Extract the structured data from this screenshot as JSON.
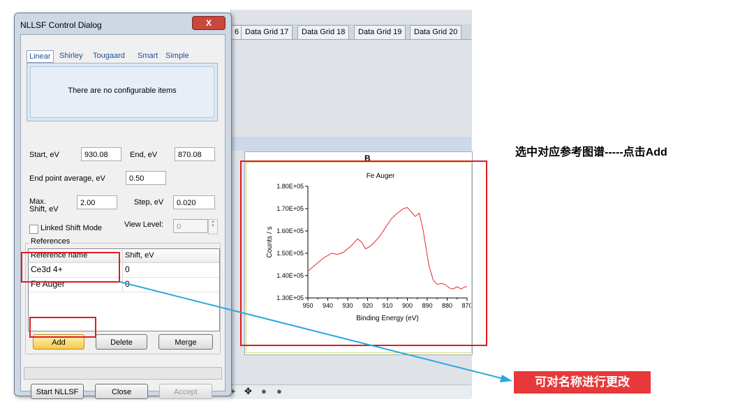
{
  "background": {
    "tabs": [
      "6",
      "Data Grid 17",
      "Data Grid 18",
      "Data Grid 19",
      "Data Grid 20"
    ],
    "graph_letter": "B"
  },
  "dialog": {
    "title": "NLLSF Control Dialog",
    "close_label": "X",
    "background_tabs": [
      "Linear",
      "Shirley",
      "Tougaard",
      "Smart",
      "Simple"
    ],
    "no_items_text": "There are no configurable items",
    "start_label": "Start, eV",
    "start_value": "930.08",
    "end_label": "End, eV",
    "end_value": "870.08",
    "end_avg_label": "End point average, eV",
    "end_avg_value": "0.50",
    "max_shift_label": "Max. Shift, eV",
    "max_shift_value": "2.00",
    "step_label": "Step, eV",
    "step_value": "0.020",
    "linked_shift_label": "Linked Shift Mode",
    "view_level_label": "View Level:",
    "view_level_value": "0",
    "references_label": "References",
    "col_name": "Reference name",
    "col_shift": "Shift, eV",
    "rows": [
      {
        "name": "Ce3d 4+",
        "shift": "0"
      },
      {
        "name": "Fe Auger",
        "shift": "0"
      }
    ],
    "add_label": "Add",
    "delete_label": "Delete",
    "merge_label": "Merge",
    "start_nllsf_label": "Start NLLSF",
    "close_btn_label": "Close",
    "accept_label": "Accept"
  },
  "chart_data": {
    "type": "line",
    "title": "Fe Auger",
    "xlabel": "Binding Energy (eV)",
    "ylabel": "Counts / s",
    "xlim": [
      950,
      870
    ],
    "ylim": [
      130000,
      180000
    ],
    "xticks": [
      950,
      940,
      930,
      920,
      910,
      900,
      890,
      880,
      870
    ],
    "yticks": [
      "1.30E+05",
      "1.40E+05",
      "1.50E+05",
      "1.60E+05",
      "1.70E+05",
      "1.80E+05"
    ],
    "series": [
      {
        "color": "#e8262b",
        "x": [
          950,
          946,
          942,
          938,
          935,
          932,
          928,
          925,
          923,
          921,
          919,
          917,
          914,
          911,
          908,
          905,
          902,
          900,
          898,
          896,
          894,
          892,
          890,
          889,
          887,
          885,
          883,
          881,
          879,
          877,
          875,
          873,
          871,
          870
        ],
        "y": [
          142000,
          145000,
          148000,
          150000,
          149500,
          150500,
          153500,
          156500,
          155000,
          152000,
          153000,
          154500,
          157500,
          161500,
          165500,
          168000,
          170000,
          170500,
          168500,
          166500,
          168000,
          160000,
          149000,
          144000,
          138000,
          136000,
          136500,
          136000,
          134500,
          134000,
          135000,
          134000,
          135000,
          135000
        ]
      }
    ]
  },
  "annotations": {
    "top_note": "选中对应参考图谱-----点击Add",
    "bottom_note": "可对名称进行更改",
    "accent_red": "#e11b22",
    "arrow_blue": "#29a8e0"
  }
}
